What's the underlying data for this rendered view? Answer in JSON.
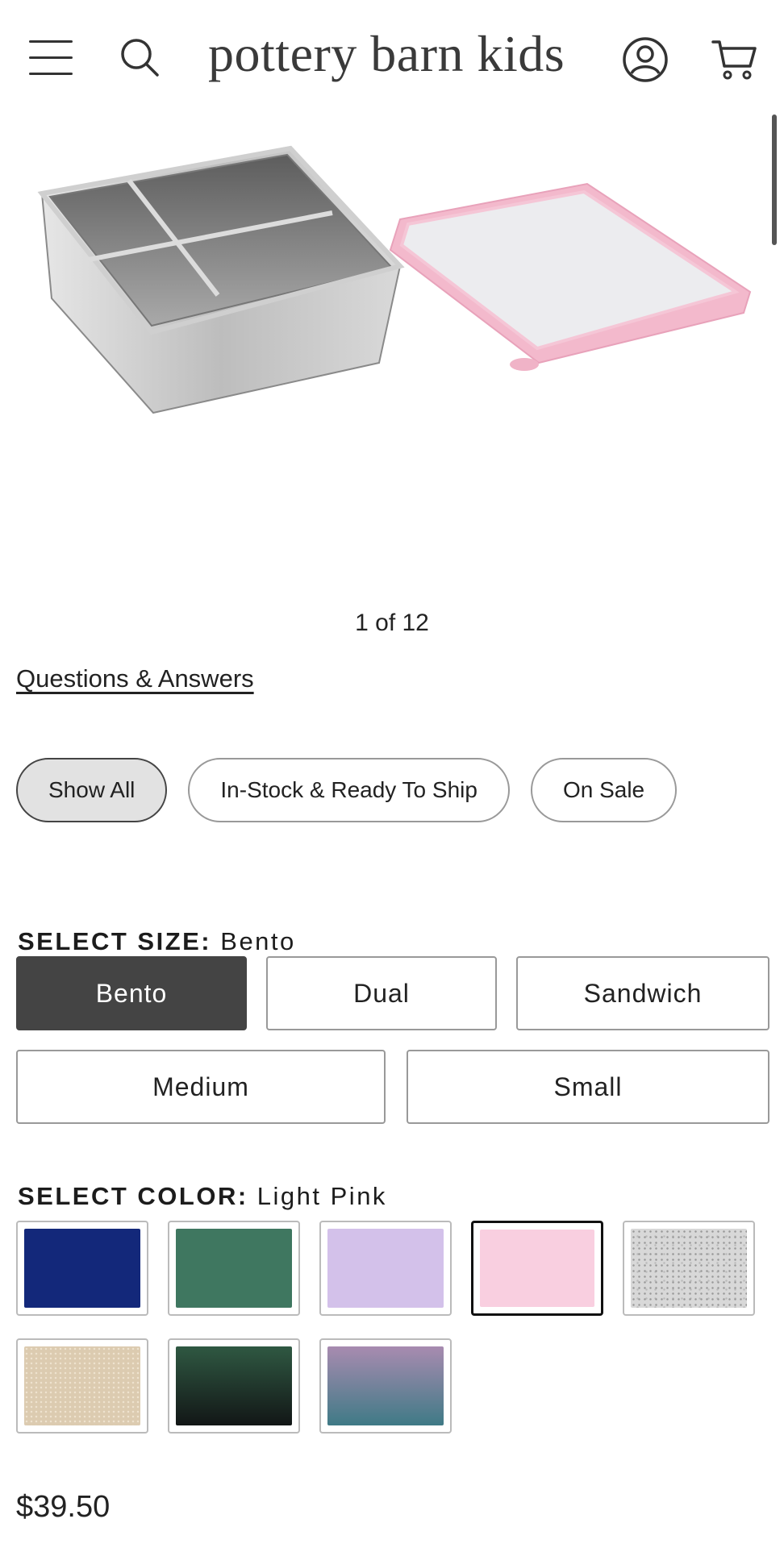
{
  "header": {
    "brand": "pottery barn kids",
    "icons": [
      "menu-icon",
      "search-icon",
      "account-icon",
      "cart-icon"
    ]
  },
  "gallery": {
    "counter": "1 of 12"
  },
  "qa_link": "Questions & Answers",
  "filters": [
    {
      "label": "Show All",
      "active": true
    },
    {
      "label": "In-Stock & Ready To Ship",
      "active": false
    },
    {
      "label": "On Sale",
      "active": false
    }
  ],
  "size": {
    "label": "SELECT SIZE:",
    "selected": "Bento",
    "options": [
      "Bento",
      "Dual",
      "Sandwich",
      "Medium",
      "Small"
    ]
  },
  "color": {
    "label": "SELECT COLOR:",
    "selected": "Light Pink",
    "swatches": [
      {
        "name": "navy",
        "color": "#13287a"
      },
      {
        "name": "green",
        "color": "#3f7760"
      },
      {
        "name": "lavender",
        "color": "#d3c1ea"
      },
      {
        "name": "light-pink",
        "color": "#f9cfe0"
      },
      {
        "name": "gray-speckle",
        "color": "#d8d8d8"
      },
      {
        "name": "sand-glitter",
        "color": "#dccbb0"
      },
      {
        "name": "green-ombre",
        "color": "#2d4a3b"
      },
      {
        "name": "purple-teal-ombre",
        "color": "#8d7fa8"
      }
    ]
  },
  "price": "$39.50"
}
